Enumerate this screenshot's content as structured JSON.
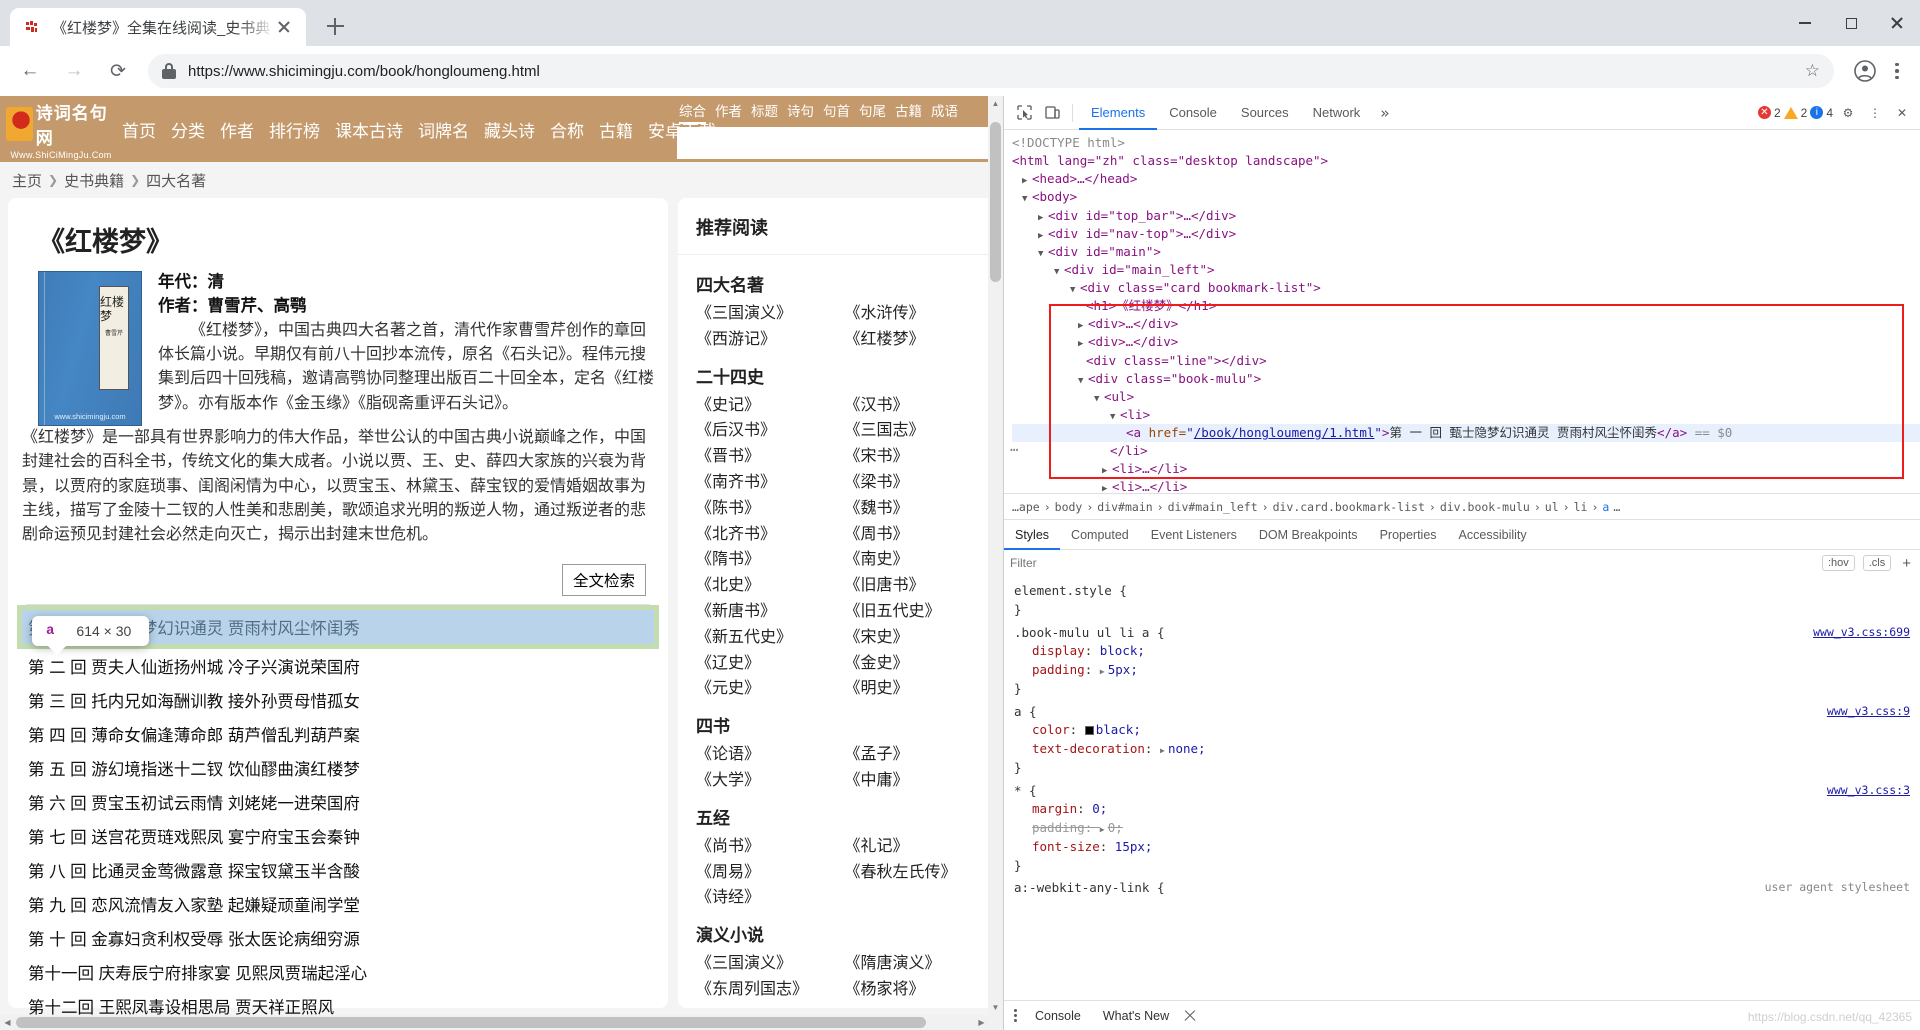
{
  "browser": {
    "tab_title": "《红楼梦》全集在线阅读_史书典",
    "favicon_name": "shicimingju-favicon",
    "url": "https://www.shicimingju.com/book/hongloumeng.html",
    "new_tab_label": "+",
    "back_glyph": "←",
    "forward_glyph": "→",
    "reload_glyph": "⟳",
    "star_glyph": "☆"
  },
  "site": {
    "logo_text": "诗词名句网",
    "logo_sub": "Www.ShiCiMingJu.Com",
    "nav": [
      "首页",
      "分类",
      "作者",
      "排行榜",
      "课本古诗",
      "词牌名",
      "藏头诗",
      "合称",
      "古籍",
      "安卓下载"
    ],
    "search_tabs": [
      "综合",
      "作者",
      "标题",
      "诗句",
      "句首",
      "句尾",
      "古籍",
      "成语"
    ],
    "search_active_tab": "综合",
    "search_value": "",
    "search_placeholder": ""
  },
  "breadcrumb": [
    "主页",
    "史书典籍",
    "四大名著"
  ],
  "book": {
    "title": "《红楼梦》",
    "cover_label": "红楼梦",
    "cover_signature": "曹雪芹",
    "cover_watermark": "www.shicimingju.com",
    "era_label": "年代：清",
    "author_label": "作者：曹雪芹、高鹗",
    "desc_p1": "《红楼梦》，中国古典四大名著之首，清代作家曹雪芹创作的章回体长篇小说。早期仅有前八十回抄本流传，原名《石头记》。程伟元搜集到后四十回残稿，邀请高鹗协同整理出版百二十回全本，定名《红楼梦》。亦有版本作《金玉缘》《脂砚斋重评石头记》。",
    "desc_p2": "《红楼梦》是一部具有世界影响力的伟大作品，举世公认的中国古典小说巅峰之作，中国封建社会的百科全书，传统文化的集大成者。小说以贾、王、史、薛四大家族的兴衰为背景，以贾府的家庭琐事、闺阁闲情为中心，以贾宝玉、林黛玉、薛宝钗的爱情婚姻故事为主线，描写了金陵十二钗的人性美和悲剧美，歌颂追求光明的叛逆人物，通过叛逆者的悲剧命运预见封建社会必然走向灭亡，揭示出封建末世危机。",
    "fulltext_button": "全文检索"
  },
  "tooltip": {
    "tag": "a",
    "dimensions": "614 × 30"
  },
  "chapters": [
    "第 一 回 甄士隐梦幻识通灵 贾雨村风尘怀闺秀",
    "第 二 回 贾夫人仙逝扬州城 冷子兴演说荣国府",
    "第 三 回 托内兄如海酬训教 接外孙贾母惜孤女",
    "第 四 回 薄命女偏逢薄命郎 葫芦僧乱判葫芦案",
    "第 五 回 游幻境指迷十二钗 饮仙醪曲演红楼梦",
    "第 六 回 贾宝玉初试云雨情 刘姥姥一进荣国府",
    "第 七 回 送宫花贾琏戏熙凤 宴宁府宝玉会秦钟",
    "第 八 回 比通灵金莺微露意 探宝钗黛玉半含酸",
    "第 九 回 恋风流情友入家塾 起嫌疑顽童闹学堂",
    "第 十 回 金寡妇贪利权受辱 张太医论病细穷源",
    "第十一回 庆寿辰宁府排家宴 见熙凤贾瑞起淫心",
    "第十二回 王熙凤毒设相思局 贾天祥正照风"
  ],
  "chapter_highlight_index": 0,
  "sidebar": {
    "title": "推荐阅读",
    "groups": [
      {
        "name": "四大名著",
        "items": [
          "《三国演义》",
          "《水浒传》",
          "《西游记》",
          "《红楼梦》"
        ]
      },
      {
        "name": "二十四史",
        "items": [
          "《史记》",
          "《汉书》",
          "《后汉书》",
          "《三国志》",
          "《晋书》",
          "《宋书》",
          "《南齐书》",
          "《梁书》",
          "《陈书》",
          "《魏书》",
          "《北齐书》",
          "《周书》",
          "《隋书》",
          "《南史》",
          "《北史》",
          "《旧唐书》",
          "《新唐书》",
          "《旧五代史》",
          "《新五代史》",
          "《宋史》",
          "《辽史》",
          "《金史》",
          "《元史》",
          "《明史》"
        ]
      },
      {
        "name": "四书",
        "items": [
          "《论语》",
          "《孟子》",
          "《大学》",
          "《中庸》"
        ]
      },
      {
        "name": "五经",
        "items": [
          "《尚书》",
          "《礼记》",
          "《周易》",
          "《春秋左氏传》",
          "《诗经》"
        ]
      },
      {
        "name": "演义小说",
        "items": [
          "《三国演义》",
          "《隋唐演义》",
          "《东周列国志》",
          "《杨家将》"
        ]
      }
    ]
  },
  "devtools": {
    "inspect_icon": "cursor-select-icon",
    "device_icon": "device-toolbar-icon",
    "tabs": [
      "Elements",
      "Console",
      "Sources",
      "Network"
    ],
    "active_tab": "Elements",
    "more_tabs_glyph": "»",
    "counts": {
      "errors": "2",
      "warnings": "2",
      "info": "4"
    },
    "gear_glyph": "⚙",
    "kebab_glyph": "⋮",
    "close_glyph": "✕",
    "dom": {
      "doctype": "<!DOCTYPE html>",
      "html_open": "<html lang=\"zh\" class=\"desktop landscape\">",
      "head_line": "<head>…</head>",
      "body_open": "<body>",
      "topbar_line": "<div id=\"top_bar\">…</div>",
      "navtop_line": "<div id=\"nav-top\">…</div>",
      "main_open": "<div id=\"main\">",
      "mainleft_open": "<div id=\"main_left\">",
      "card_open": "<div class=\"card bookmark-list\">",
      "h1_line": "<h1>《红楼梦》</h1>",
      "div_collapsed_1": "<div>…</div>",
      "div_collapsed_2": "<div>…</div>",
      "line_div": "<div class=\"line\"></div>",
      "bookmulu_open": "<div class=\"book-mulu\">",
      "ul_open": "<ul>",
      "li_open": "<li>",
      "anchor_href": "/book/hongloumeng/1.html",
      "anchor_text": "第 一 回 甄士隐梦幻识通灵 贾雨村风尘怀闺秀",
      "anchor_suffix": "== $0",
      "li_close": "</li>",
      "li_collapsed": "<li>…</li>",
      "li_collapsed_2": "<li>…</li>"
    },
    "breadcrumb": [
      "…ape",
      "body",
      "div#main",
      "div#main_left",
      "div.card.bookmark-list",
      "div.book-mulu",
      "ul",
      "li",
      "a",
      "…"
    ],
    "subtabs": [
      "Styles",
      "Computed",
      "Event Listeners",
      "DOM Breakpoints",
      "Properties",
      "Accessibility"
    ],
    "active_subtab": "Styles",
    "filter_placeholder": "Filter",
    "filter_value": "",
    "hov_chip": ":hov",
    "cls_chip": ".cls",
    "plus_glyph": "+",
    "styles": [
      {
        "selector": "element.style {",
        "source": "",
        "decls": [],
        "close": "}"
      },
      {
        "selector": ".book-mulu ul li a {",
        "source": "www_v3.css:699",
        "decls": [
          {
            "prop": "display",
            "value": "block;",
            "expand": false,
            "swatch": null,
            "struck": false
          },
          {
            "prop": "padding",
            "value": "5px;",
            "expand": true,
            "swatch": null,
            "struck": false
          }
        ],
        "close": "}"
      },
      {
        "selector": "a {",
        "source": "www_v3.css:9",
        "decls": [
          {
            "prop": "color",
            "value": "black;",
            "expand": false,
            "swatch": "#000000",
            "struck": false
          },
          {
            "prop": "text-decoration",
            "value": "none;",
            "expand": true,
            "swatch": null,
            "struck": false
          }
        ],
        "close": "}"
      },
      {
        "selector": "* {",
        "source": "www_v3.css:3",
        "decls": [
          {
            "prop": "margin",
            "value": "0;",
            "expand": false,
            "swatch": null,
            "struck": false
          },
          {
            "prop": "padding",
            "value": "0;",
            "expand": true,
            "swatch": null,
            "struck": true
          },
          {
            "prop": "font-size",
            "value": "15px;",
            "expand": false,
            "swatch": null,
            "struck": false
          }
        ],
        "close": "}"
      },
      {
        "selector": "a:-webkit-any-link {",
        "source": "user agent stylesheet",
        "decls": [],
        "close": ""
      }
    ],
    "drawer": {
      "kebab": "⋮",
      "tabs": [
        "Console",
        "What's New"
      ],
      "active": "Console",
      "close_glyph": "✕"
    },
    "watermark": "https://blog.csdn.net/qq_42365"
  }
}
